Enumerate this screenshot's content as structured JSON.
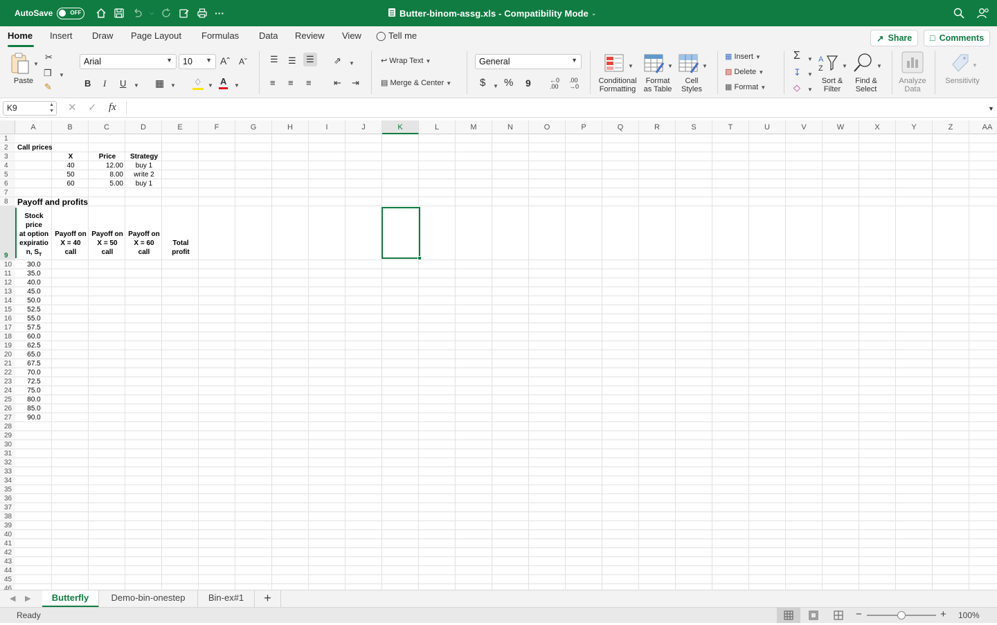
{
  "titlebar": {
    "autosave_label": "AutoSave",
    "autosave_state": "OFF",
    "document_title": "Butter-binom-assg.xls  -  Compatibility Mode",
    "bg_color": "#107c41"
  },
  "ribbon_tabs": [
    "Home",
    "Insert",
    "Draw",
    "Page Layout",
    "Formulas",
    "Data",
    "Review",
    "View",
    "Tell me"
  ],
  "top_buttons": {
    "share": "Share",
    "comments": "Comments"
  },
  "ribbon": {
    "paste": "Paste",
    "font_name": "Arial",
    "font_size": "10",
    "wrap_text": "Wrap Text",
    "merge_center": "Merge & Center",
    "number_format": "General",
    "conditional_formatting": [
      "Conditional",
      "Formatting"
    ],
    "format_as_table": [
      "Format",
      "as Table"
    ],
    "cell_styles": [
      "Cell",
      "Styles"
    ],
    "insert": "Insert",
    "delete": "Delete",
    "format": "Format",
    "sort_filter": [
      "Sort &",
      "Filter"
    ],
    "find_select": [
      "Find &",
      "Select"
    ],
    "analyze_data": [
      "Analyze",
      "Data"
    ],
    "sensitivity": "Sensitivity",
    "bold": "B",
    "italic": "I",
    "underline": "U",
    "dollar": "$",
    "percent": "%",
    "comma": "9"
  },
  "formula_bar": {
    "name_box": "K9",
    "fx": "fx",
    "content": ""
  },
  "columns": [
    "A",
    "B",
    "C",
    "D",
    "E",
    "F",
    "G",
    "H",
    "I",
    "J",
    "K",
    "L",
    "M",
    "N",
    "O",
    "P",
    "Q",
    "R",
    "S",
    "T",
    "U",
    "V",
    "W",
    "X",
    "Y",
    "Z",
    "AA"
  ],
  "selected_cell": "K9",
  "cells": {
    "a2": "Call prices",
    "b3": "X",
    "c3": "Price",
    "d3": "Strategy",
    "b4": "40",
    "c4": "12.00",
    "d4": "buy 1",
    "b5": "50",
    "c5": "8.00",
    "d5": "write 2",
    "b6": "60",
    "c6": "5.00",
    "d6": "buy 1",
    "a8": "Payoff and profits",
    "a9": [
      "Stock",
      "price",
      "at option",
      "expiratio",
      "n, S"
    ],
    "a9_sub": "T",
    "b9": [
      "Payoff on",
      "X = 40",
      "call"
    ],
    "c9": [
      "Payoff on",
      "X = 50",
      "call"
    ],
    "d9": [
      "Payoff on",
      "X = 60",
      "call"
    ],
    "e9": [
      "Total",
      "profit"
    ]
  },
  "stock_prices": [
    "30.0",
    "35.0",
    "40.0",
    "45.0",
    "50.0",
    "52.5",
    "55.0",
    "57.5",
    "60.0",
    "62.5",
    "65.0",
    "67.5",
    "70.0",
    "72.5",
    "75.0",
    "80.0",
    "85.0",
    "90.0"
  ],
  "sheet_tabs": [
    "Butterfly",
    "Demo-bin-onestep",
    "Bin-ex#1"
  ],
  "active_sheet": "Butterfly",
  "status": {
    "ready": "Ready",
    "zoom": "100%",
    "zoom_level": 1.0
  }
}
